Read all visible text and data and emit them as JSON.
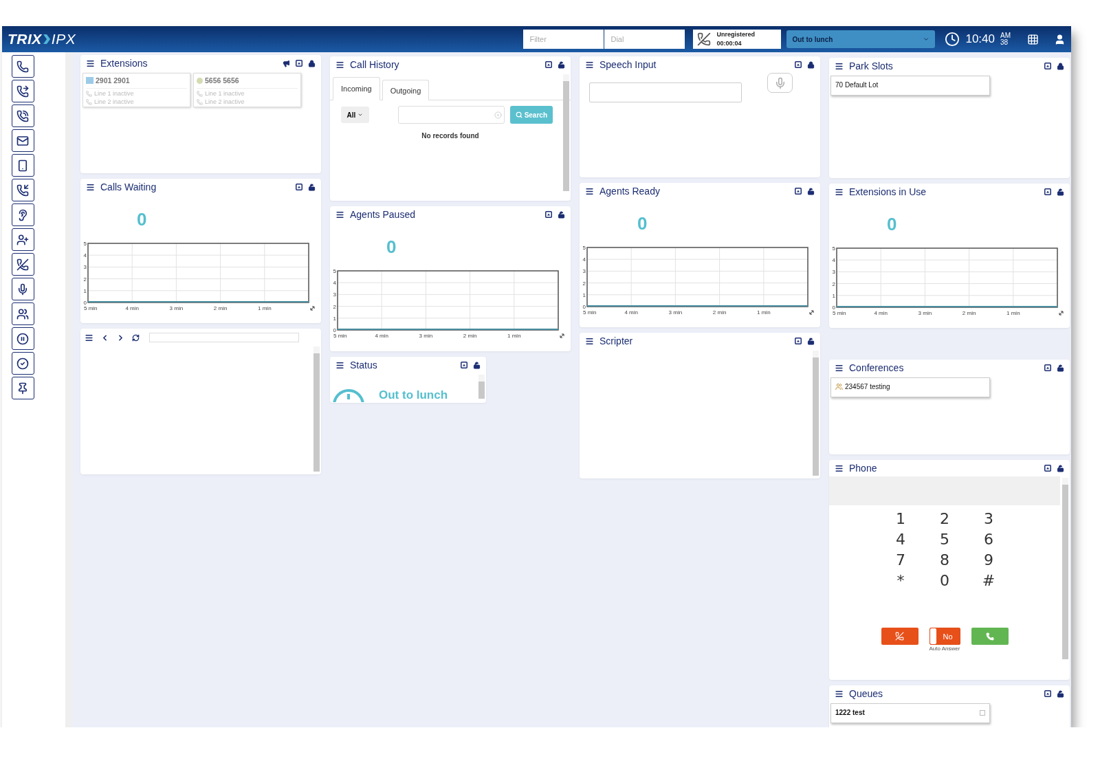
{
  "header": {
    "logo_left": "TRIX",
    "logo_right": "IPX",
    "filter": {
      "placeholder": "Filter"
    },
    "dial": {
      "placeholder": "Dial"
    },
    "registration": {
      "status": "Unregistered",
      "timer": "00:00:04"
    },
    "presence": "Out to lunch",
    "clock": {
      "time": "10:40",
      "ampm": "AM",
      "seconds": "38"
    }
  },
  "extensions": {
    "title": "Extensions",
    "locked": true,
    "cards": [
      {
        "name": "2901 2901",
        "kind": "contact",
        "lines": [
          "Line 1 inactive",
          "Line 2 inactive"
        ]
      },
      {
        "name": "5656 5656",
        "kind": "dot",
        "lines": [
          "Line 1 inactive",
          "Line 2 inactive"
        ]
      }
    ]
  },
  "calls_waiting": {
    "title": "Calls Waiting",
    "locked": false,
    "count": "0",
    "chart_data": {
      "type": "line",
      "grid": true,
      "categories": [
        "5 min",
        "4 min",
        "3 min",
        "2 min",
        "1 min",
        null
      ],
      "ylim": [
        0,
        5
      ],
      "yticks": [
        0,
        1,
        2,
        3,
        4,
        5
      ],
      "series": [
        {
          "color": "#4a8fa0",
          "values": [
            0,
            0,
            0,
            0,
            0,
            0
          ]
        }
      ]
    }
  },
  "call_history": {
    "title": "Call History",
    "locked": false,
    "tabs": [
      {
        "label": "Incoming",
        "selected": true
      },
      {
        "label": "Outgoing",
        "selected": false
      }
    ],
    "filter": "All",
    "search_button": "Search",
    "empty": "No records found"
  },
  "agents_paused": {
    "title": "Agents Paused",
    "locked": false,
    "count": "0",
    "chart_data": {
      "type": "line",
      "grid": true,
      "categories": [
        "5 min",
        "4 min",
        "3 min",
        "2 min",
        "1 min",
        null
      ],
      "ylim": [
        0,
        5
      ],
      "yticks": [
        0,
        1,
        2,
        3,
        4,
        5
      ],
      "series": [
        {
          "color": "#4a8fa0",
          "values": [
            0,
            0,
            0,
            0,
            0,
            0
          ]
        }
      ]
    }
  },
  "status": {
    "title": "Status",
    "locked": false,
    "presence": "Out to lunch"
  },
  "speech_input": {
    "title": "Speech Input",
    "locked": true
  },
  "agents_ready": {
    "title": "Agents Ready",
    "locked": false,
    "count": "0",
    "chart_data": {
      "type": "line",
      "grid": true,
      "categories": [
        "5 min",
        "4 min",
        "3 min",
        "2 min",
        "1 min",
        null
      ],
      "ylim": [
        0,
        5
      ],
      "yticks": [
        0,
        1,
        2,
        3,
        4,
        5
      ],
      "series": [
        {
          "color": "#4a8fa0",
          "values": [
            0,
            0,
            0,
            0,
            0,
            0
          ]
        }
      ]
    }
  },
  "scripter": {
    "title": "Scripter",
    "locked": false
  },
  "park_slots": {
    "title": "Park Slots",
    "locked": true,
    "items": [
      "70 Default Lot"
    ]
  },
  "extensions_in_use": {
    "title": "Extensions in Use",
    "locked": false,
    "count": "0",
    "chart_data": {
      "type": "line",
      "grid": true,
      "categories": [
        "5 min",
        "4 min",
        "3 min",
        "2 min",
        "1 min",
        null
      ],
      "ylim": [
        0,
        5
      ],
      "yticks": [
        0,
        1,
        2,
        3,
        4,
        5
      ],
      "series": [
        {
          "color": "#4a8fa0",
          "values": [
            0,
            0,
            0,
            0,
            0,
            0
          ]
        }
      ]
    }
  },
  "conferences": {
    "title": "Conferences",
    "locked": false,
    "items": [
      "234567 testing"
    ]
  },
  "phone": {
    "title": "Phone",
    "locked": false,
    "keys": [
      "1",
      "2",
      "3",
      "4",
      "5",
      "6",
      "7",
      "8",
      "9",
      "*",
      "0",
      "#"
    ],
    "auto_answer": {
      "on": false,
      "text": "No",
      "label": "Auto Answer"
    }
  },
  "queues": {
    "title": "Queues",
    "locked": false,
    "items": [
      "1222 test"
    ]
  }
}
